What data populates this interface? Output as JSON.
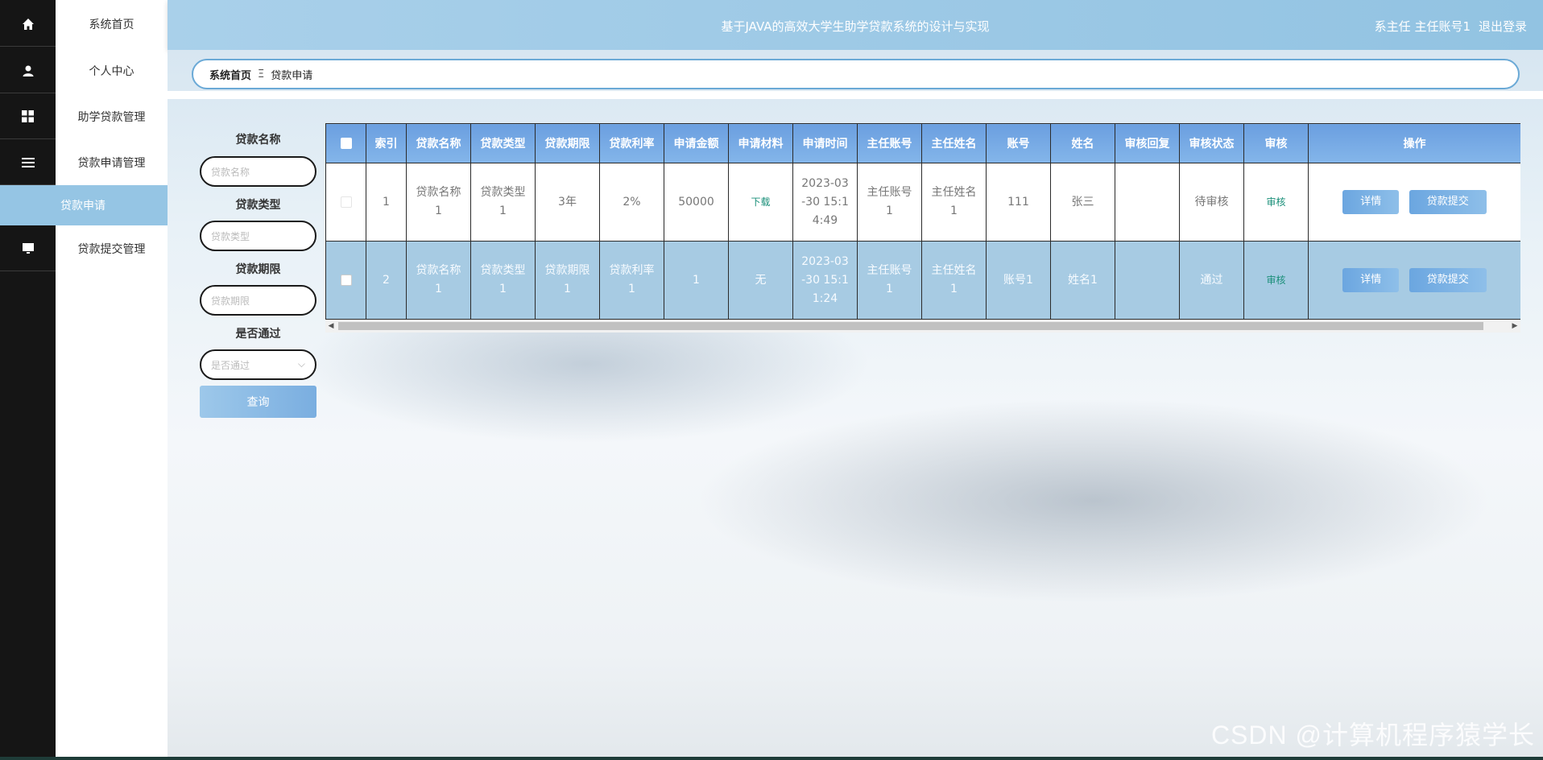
{
  "sidebar": {
    "items": [
      {
        "label": "系统首页",
        "icon": "home-icon"
      },
      {
        "label": "个人中心",
        "icon": "user-icon"
      },
      {
        "label": "助学贷款管理",
        "icon": "grid-icon"
      },
      {
        "label": "贷款申请管理",
        "icon": "list-icon"
      },
      {
        "label": "贷款提交管理",
        "icon": "monitor-icon"
      }
    ],
    "active_sub": "贷款申请"
  },
  "header": {
    "title": "基于JAVA的高效大学生助学贷款系统的设计与实现",
    "user": "系主任 主任账号1",
    "logout": "退出登录"
  },
  "breadcrumb": {
    "home": "系统首页",
    "separator": "Ξ",
    "current": "贷款申请"
  },
  "search": {
    "loan_name": {
      "label": "贷款名称",
      "placeholder": "贷款名称"
    },
    "loan_type": {
      "label": "贷款类型",
      "placeholder": "贷款类型"
    },
    "loan_term": {
      "label": "贷款期限",
      "placeholder": "贷款期限"
    },
    "passed": {
      "label": "是否通过",
      "placeholder": "是否通过"
    },
    "query_button": "查询"
  },
  "table": {
    "columns": [
      "索引",
      "贷款名称",
      "贷款类型",
      "贷款期限",
      "贷款利率",
      "申请金额",
      "申请材料",
      "申请时间",
      "主任账号",
      "主任姓名",
      "账号",
      "姓名",
      "审核回复",
      "审核状态",
      "审核",
      "操作"
    ],
    "rows": [
      {
        "index": "1",
        "loan_name": [
          "贷款名称",
          "1"
        ],
        "loan_type": [
          "贷款类型",
          "1"
        ],
        "term": [
          "3年"
        ],
        "rate": [
          "2%"
        ],
        "amount": "50000",
        "material": "下载",
        "time": [
          "2023-03",
          "-30 15:1",
          "4:49"
        ],
        "dir_account": [
          "主任账号",
          "1"
        ],
        "dir_name": [
          "主任姓名",
          "1"
        ],
        "account": "111",
        "name": "张三",
        "reply": "",
        "status": "待审核",
        "audit": "审核"
      },
      {
        "index": "2",
        "loan_name": [
          "贷款名称",
          "1"
        ],
        "loan_type": [
          "贷款类型",
          "1"
        ],
        "term": [
          "贷款期限",
          "1"
        ],
        "rate": [
          "贷款利率",
          "1"
        ],
        "amount": "1",
        "material": "无",
        "time": [
          "2023-03",
          "-30 15:1",
          "1:24"
        ],
        "dir_account": [
          "主任账号",
          "1"
        ],
        "dir_name": [
          "主任姓名",
          "1"
        ],
        "account": "账号1",
        "name": "姓名1",
        "reply": "",
        "status": "通过",
        "audit": "审核"
      }
    ],
    "actions": {
      "detail": "详情",
      "submit": "贷款提交"
    }
  },
  "watermark": "CSDN @计算机程序猿学长",
  "colors": {
    "accent": "#95c5e4",
    "header": "#a9d0ea",
    "table_head": "#6b9fe0",
    "sidebar_dark": "#151515"
  }
}
